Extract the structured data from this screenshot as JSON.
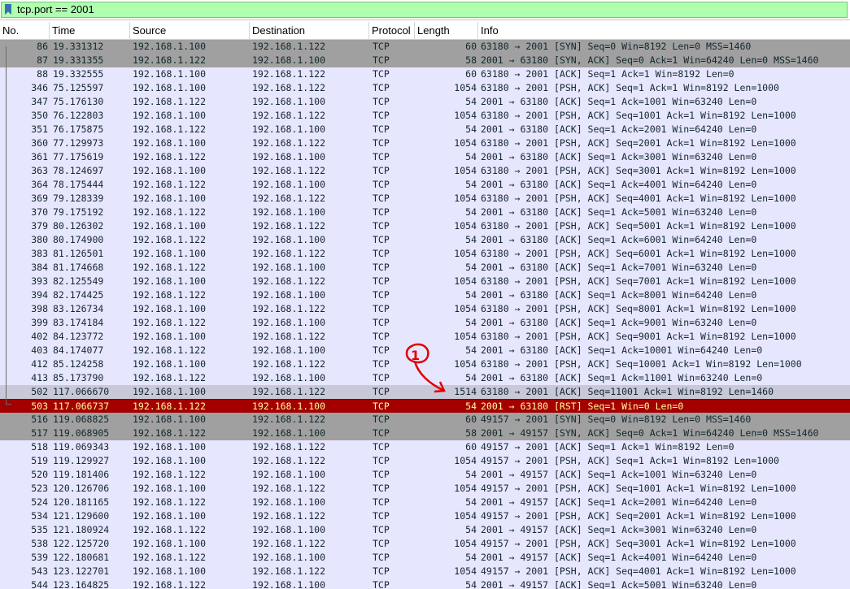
{
  "filter": {
    "text": "tcp.port == 2001",
    "bar_color": "#afffaf",
    "icon": "bookmark-icon"
  },
  "columns": [
    "No.",
    "Time",
    "Source",
    "Destination",
    "Protocol",
    "Length",
    "Info"
  ],
  "annotation": {
    "label": "1",
    "color": "#e00000"
  },
  "colors": {
    "tcp_row": "#e7e6ff",
    "syn_row": "#a0a0a0",
    "rst_row": "#a40000",
    "selected_row": "#c8c8d8"
  },
  "packets": [
    {
      "no": "86",
      "time": "19.331312",
      "src": "192.168.1.100",
      "dst": "192.168.1.122",
      "proto": "TCP",
      "len": "60",
      "info": "63180 → 2001 [SYN] Seq=0 Win=8192 Len=0 MSS=1460",
      "style": "syn"
    },
    {
      "no": "87",
      "time": "19.331355",
      "src": "192.168.1.122",
      "dst": "192.168.1.100",
      "proto": "TCP",
      "len": "58",
      "info": "2001 → 63180 [SYN, ACK] Seq=0 Ack=1 Win=64240 Len=0 MSS=1460",
      "style": "syn"
    },
    {
      "no": "88",
      "time": "19.332555",
      "src": "192.168.1.100",
      "dst": "192.168.1.122",
      "proto": "TCP",
      "len": "60",
      "info": "63180 → 2001 [ACK] Seq=1 Ack=1 Win=8192 Len=0",
      "style": "tcp"
    },
    {
      "no": "346",
      "time": "75.125597",
      "src": "192.168.1.100",
      "dst": "192.168.1.122",
      "proto": "TCP",
      "len": "1054",
      "info": "63180 → 2001 [PSH, ACK] Seq=1 Ack=1 Win=8192 Len=1000",
      "style": "tcp"
    },
    {
      "no": "347",
      "time": "75.176130",
      "src": "192.168.1.122",
      "dst": "192.168.1.100",
      "proto": "TCP",
      "len": "54",
      "info": "2001 → 63180 [ACK] Seq=1 Ack=1001 Win=63240 Len=0",
      "style": "tcp"
    },
    {
      "no": "350",
      "time": "76.122803",
      "src": "192.168.1.100",
      "dst": "192.168.1.122",
      "proto": "TCP",
      "len": "1054",
      "info": "63180 → 2001 [PSH, ACK] Seq=1001 Ack=1 Win=8192 Len=1000",
      "style": "tcp"
    },
    {
      "no": "351",
      "time": "76.175875",
      "src": "192.168.1.122",
      "dst": "192.168.1.100",
      "proto": "TCP",
      "len": "54",
      "info": "2001 → 63180 [ACK] Seq=1 Ack=2001 Win=64240 Len=0",
      "style": "tcp"
    },
    {
      "no": "360",
      "time": "77.129973",
      "src": "192.168.1.100",
      "dst": "192.168.1.122",
      "proto": "TCP",
      "len": "1054",
      "info": "63180 → 2001 [PSH, ACK] Seq=2001 Ack=1 Win=8192 Len=1000",
      "style": "tcp"
    },
    {
      "no": "361",
      "time": "77.175619",
      "src": "192.168.1.122",
      "dst": "192.168.1.100",
      "proto": "TCP",
      "len": "54",
      "info": "2001 → 63180 [ACK] Seq=1 Ack=3001 Win=63240 Len=0",
      "style": "tcp"
    },
    {
      "no": "363",
      "time": "78.124697",
      "src": "192.168.1.100",
      "dst": "192.168.1.122",
      "proto": "TCP",
      "len": "1054",
      "info": "63180 → 2001 [PSH, ACK] Seq=3001 Ack=1 Win=8192 Len=1000",
      "style": "tcp"
    },
    {
      "no": "364",
      "time": "78.175444",
      "src": "192.168.1.122",
      "dst": "192.168.1.100",
      "proto": "TCP",
      "len": "54",
      "info": "2001 → 63180 [ACK] Seq=1 Ack=4001 Win=64240 Len=0",
      "style": "tcp"
    },
    {
      "no": "369",
      "time": "79.128339",
      "src": "192.168.1.100",
      "dst": "192.168.1.122",
      "proto": "TCP",
      "len": "1054",
      "info": "63180 → 2001 [PSH, ACK] Seq=4001 Ack=1 Win=8192 Len=1000",
      "style": "tcp"
    },
    {
      "no": "370",
      "time": "79.175192",
      "src": "192.168.1.122",
      "dst": "192.168.1.100",
      "proto": "TCP",
      "len": "54",
      "info": "2001 → 63180 [ACK] Seq=1 Ack=5001 Win=63240 Len=0",
      "style": "tcp"
    },
    {
      "no": "379",
      "time": "80.126302",
      "src": "192.168.1.100",
      "dst": "192.168.1.122",
      "proto": "TCP",
      "len": "1054",
      "info": "63180 → 2001 [PSH, ACK] Seq=5001 Ack=1 Win=8192 Len=1000",
      "style": "tcp"
    },
    {
      "no": "380",
      "time": "80.174900",
      "src": "192.168.1.122",
      "dst": "192.168.1.100",
      "proto": "TCP",
      "len": "54",
      "info": "2001 → 63180 [ACK] Seq=1 Ack=6001 Win=64240 Len=0",
      "style": "tcp"
    },
    {
      "no": "383",
      "time": "81.126501",
      "src": "192.168.1.100",
      "dst": "192.168.1.122",
      "proto": "TCP",
      "len": "1054",
      "info": "63180 → 2001 [PSH, ACK] Seq=6001 Ack=1 Win=8192 Len=1000",
      "style": "tcp"
    },
    {
      "no": "384",
      "time": "81.174668",
      "src": "192.168.1.122",
      "dst": "192.168.1.100",
      "proto": "TCP",
      "len": "54",
      "info": "2001 → 63180 [ACK] Seq=1 Ack=7001 Win=63240 Len=0",
      "style": "tcp"
    },
    {
      "no": "393",
      "time": "82.125549",
      "src": "192.168.1.100",
      "dst": "192.168.1.122",
      "proto": "TCP",
      "len": "1054",
      "info": "63180 → 2001 [PSH, ACK] Seq=7001 Ack=1 Win=8192 Len=1000",
      "style": "tcp"
    },
    {
      "no": "394",
      "time": "82.174425",
      "src": "192.168.1.122",
      "dst": "192.168.1.100",
      "proto": "TCP",
      "len": "54",
      "info": "2001 → 63180 [ACK] Seq=1 Ack=8001 Win=64240 Len=0",
      "style": "tcp"
    },
    {
      "no": "398",
      "time": "83.126734",
      "src": "192.168.1.100",
      "dst": "192.168.1.122",
      "proto": "TCP",
      "len": "1054",
      "info": "63180 → 2001 [PSH, ACK] Seq=8001 Ack=1 Win=8192 Len=1000",
      "style": "tcp"
    },
    {
      "no": "399",
      "time": "83.174184",
      "src": "192.168.1.122",
      "dst": "192.168.1.100",
      "proto": "TCP",
      "len": "54",
      "info": "2001 → 63180 [ACK] Seq=1 Ack=9001 Win=63240 Len=0",
      "style": "tcp"
    },
    {
      "no": "402",
      "time": "84.123772",
      "src": "192.168.1.100",
      "dst": "192.168.1.122",
      "proto": "TCP",
      "len": "1054",
      "info": "63180 → 2001 [PSH, ACK] Seq=9001 Ack=1 Win=8192 Len=1000",
      "style": "tcp"
    },
    {
      "no": "403",
      "time": "84.174077",
      "src": "192.168.1.122",
      "dst": "192.168.1.100",
      "proto": "TCP",
      "len": "54",
      "info": "2001 → 63180 [ACK] Seq=1 Ack=10001 Win=64240 Len=0",
      "style": "tcp"
    },
    {
      "no": "412",
      "time": "85.124258",
      "src": "192.168.1.100",
      "dst": "192.168.1.122",
      "proto": "TCP",
      "len": "1054",
      "info": "63180 → 2001 [PSH, ACK] Seq=10001 Ack=1 Win=8192 Len=1000",
      "style": "tcp"
    },
    {
      "no": "413",
      "time": "85.173790",
      "src": "192.168.1.122",
      "dst": "192.168.1.100",
      "proto": "TCP",
      "len": "54",
      "info": "2001 → 63180 [ACK] Seq=1 Ack=11001 Win=63240 Len=0",
      "style": "tcp"
    },
    {
      "no": "502",
      "time": "117.066670",
      "src": "192.168.1.100",
      "dst": "192.168.1.122",
      "proto": "TCP",
      "len": "1514",
      "info": "63180 → 2001 [ACK] Seq=11001 Ack=1 Win=8192 Len=1460",
      "style": "selected"
    },
    {
      "no": "503",
      "time": "117.066737",
      "src": "192.168.1.122",
      "dst": "192.168.1.100",
      "proto": "TCP",
      "len": "54",
      "info": "2001 → 63180 [RST] Seq=1 Win=0 Len=0",
      "style": "rst"
    },
    {
      "no": "516",
      "time": "119.068825",
      "src": "192.168.1.100",
      "dst": "192.168.1.122",
      "proto": "TCP",
      "len": "60",
      "info": "49157 → 2001 [SYN] Seq=0 Win=8192 Len=0 MSS=1460",
      "style": "syn"
    },
    {
      "no": "517",
      "time": "119.068905",
      "src": "192.168.1.122",
      "dst": "192.168.1.100",
      "proto": "TCP",
      "len": "58",
      "info": "2001 → 49157 [SYN, ACK] Seq=0 Ack=1 Win=64240 Len=0 MSS=1460",
      "style": "syn"
    },
    {
      "no": "518",
      "time": "119.069343",
      "src": "192.168.1.100",
      "dst": "192.168.1.122",
      "proto": "TCP",
      "len": "60",
      "info": "49157 → 2001 [ACK] Seq=1 Ack=1 Win=8192 Len=0",
      "style": "tcp"
    },
    {
      "no": "519",
      "time": "119.129927",
      "src": "192.168.1.100",
      "dst": "192.168.1.122",
      "proto": "TCP",
      "len": "1054",
      "info": "49157 → 2001 [PSH, ACK] Seq=1 Ack=1 Win=8192 Len=1000",
      "style": "tcp"
    },
    {
      "no": "520",
      "time": "119.181406",
      "src": "192.168.1.122",
      "dst": "192.168.1.100",
      "proto": "TCP",
      "len": "54",
      "info": "2001 → 49157 [ACK] Seq=1 Ack=1001 Win=63240 Len=0",
      "style": "tcp"
    },
    {
      "no": "523",
      "time": "120.126706",
      "src": "192.168.1.100",
      "dst": "192.168.1.122",
      "proto": "TCP",
      "len": "1054",
      "info": "49157 → 2001 [PSH, ACK] Seq=1001 Ack=1 Win=8192 Len=1000",
      "style": "tcp"
    },
    {
      "no": "524",
      "time": "120.181165",
      "src": "192.168.1.122",
      "dst": "192.168.1.100",
      "proto": "TCP",
      "len": "54",
      "info": "2001 → 49157 [ACK] Seq=1 Ack=2001 Win=64240 Len=0",
      "style": "tcp"
    },
    {
      "no": "534",
      "time": "121.129600",
      "src": "192.168.1.100",
      "dst": "192.168.1.122",
      "proto": "TCP",
      "len": "1054",
      "info": "49157 → 2001 [PSH, ACK] Seq=2001 Ack=1 Win=8192 Len=1000",
      "style": "tcp"
    },
    {
      "no": "535",
      "time": "121.180924",
      "src": "192.168.1.122",
      "dst": "192.168.1.100",
      "proto": "TCP",
      "len": "54",
      "info": "2001 → 49157 [ACK] Seq=1 Ack=3001 Win=63240 Len=0",
      "style": "tcp"
    },
    {
      "no": "538",
      "time": "122.125720",
      "src": "192.168.1.100",
      "dst": "192.168.1.122",
      "proto": "TCP",
      "len": "1054",
      "info": "49157 → 2001 [PSH, ACK] Seq=3001 Ack=1 Win=8192 Len=1000",
      "style": "tcp"
    },
    {
      "no": "539",
      "time": "122.180681",
      "src": "192.168.1.122",
      "dst": "192.168.1.100",
      "proto": "TCP",
      "len": "54",
      "info": "2001 → 49157 [ACK] Seq=1 Ack=4001 Win=64240 Len=0",
      "style": "tcp"
    },
    {
      "no": "543",
      "time": "123.122701",
      "src": "192.168.1.100",
      "dst": "192.168.1.122",
      "proto": "TCP",
      "len": "1054",
      "info": "49157 → 2001 [PSH, ACK] Seq=4001 Ack=1 Win=8192 Len=1000",
      "style": "tcp"
    },
    {
      "no": "544",
      "time": "123.164825",
      "src": "192.168.1.122",
      "dst": "192.168.1.100",
      "proto": "TCP",
      "len": "54",
      "info": "2001 → 49157 [ACK] Seq=1 Ack=5001 Win=63240 Len=0",
      "style": "tcp"
    }
  ]
}
